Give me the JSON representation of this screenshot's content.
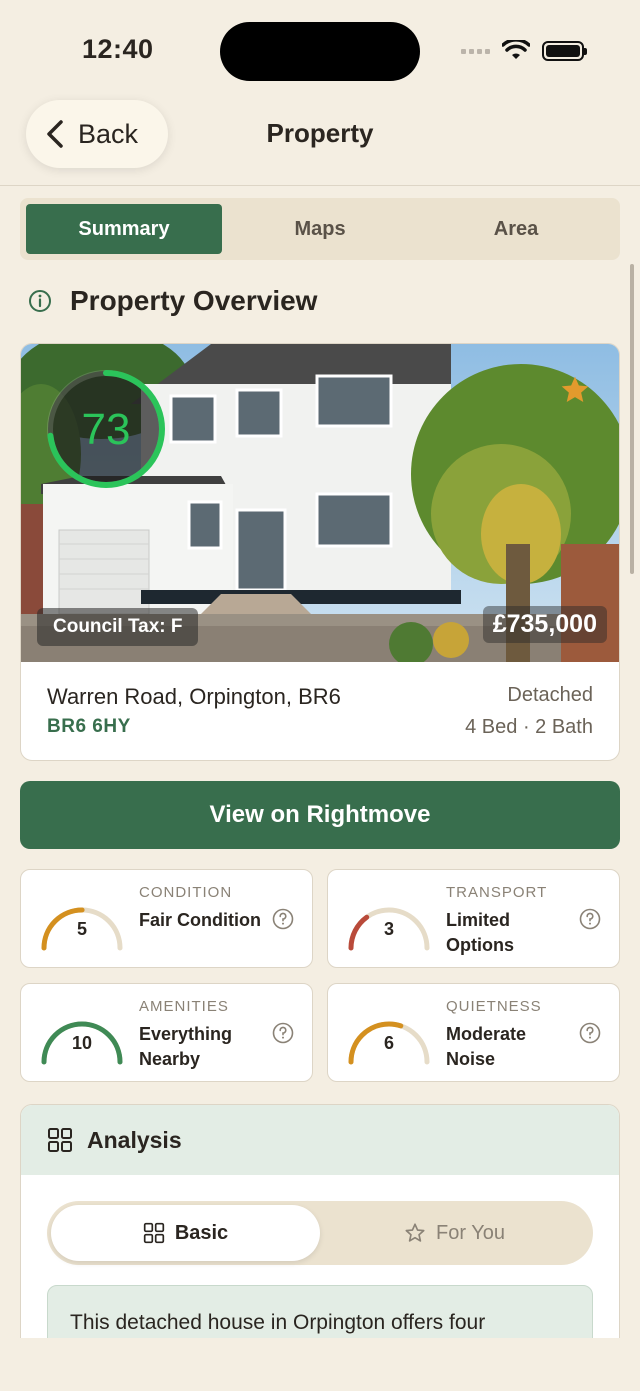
{
  "status": {
    "time": "12:40"
  },
  "nav": {
    "back_label": "Back",
    "title": "Property"
  },
  "tabs": [
    {
      "label": "Summary",
      "active": true
    },
    {
      "label": "Maps",
      "active": false
    },
    {
      "label": "Area",
      "active": false
    }
  ],
  "overview": {
    "heading": "Property Overview",
    "score": "73",
    "score_fraction": 0.73,
    "council_tax": "Council Tax: F",
    "price": "£735,000",
    "address": "Warren Road, Orpington, BR6",
    "postcode": "BR6 6HY",
    "property_type": "Detached",
    "beds_baths": "4 Bed · 2 Bath"
  },
  "rightmove_button": "View on Rightmove",
  "metrics": [
    {
      "label": "CONDITION",
      "score": "5",
      "fraction": 0.5,
      "desc": "Fair Condition",
      "color": "#d4901f"
    },
    {
      "label": "TRANSPORT",
      "score": "3",
      "fraction": 0.3,
      "desc": "Limited Options",
      "color": "#b94a3a"
    },
    {
      "label": "AMENITIES",
      "score": "10",
      "fraction": 1.0,
      "desc": "Everything Nearby",
      "color": "#3f8a55"
    },
    {
      "label": "QUIETNESS",
      "score": "6",
      "fraction": 0.6,
      "desc": "Moderate Noise",
      "color": "#d4901f"
    }
  ],
  "analysis": {
    "title": "Analysis",
    "toggle_basic": "Basic",
    "toggle_foryou": "For You",
    "summary_text": "This detached house in Orpington offers four"
  },
  "colors": {
    "accent": "#386e4d",
    "background": "#f4eee2",
    "score_ring": "#2bc45a",
    "star": "#e39a2d"
  }
}
